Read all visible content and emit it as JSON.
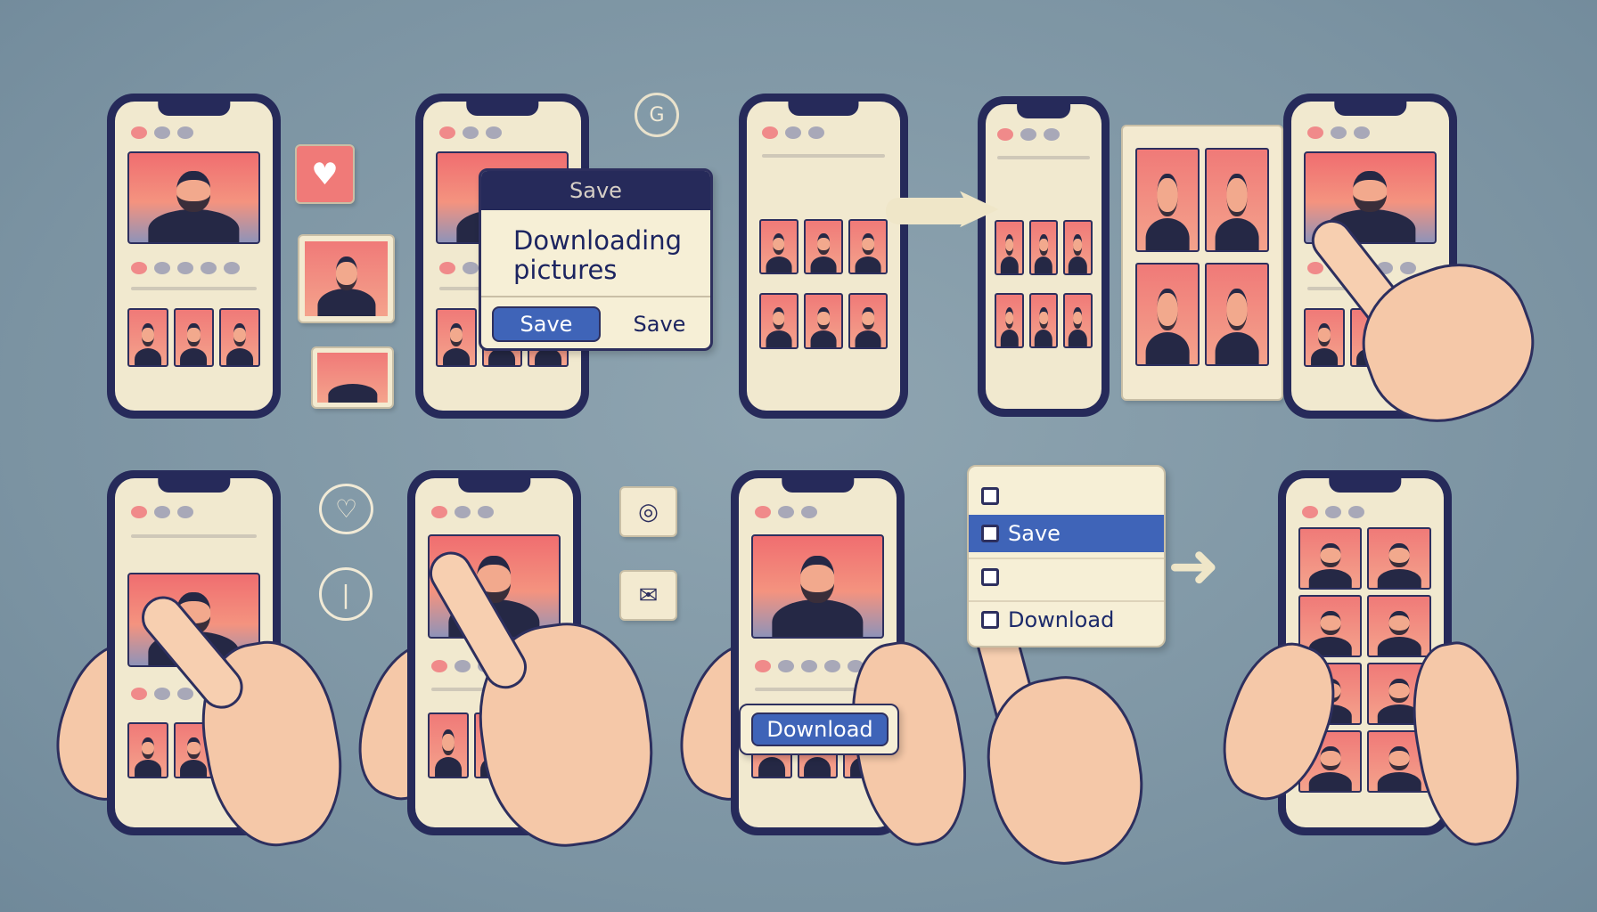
{
  "dialog": {
    "header": "Save",
    "message": "Downloading pictures",
    "primary_button": "Save",
    "secondary_button": "Save"
  },
  "menu": {
    "items": [
      "",
      "Save",
      "",
      "Download"
    ]
  },
  "download_button": "Download",
  "colors": {
    "background": "#7f97a5",
    "phone_frame": "#262a5a",
    "screen": "#f1e9cf",
    "accent_blue": "#3f64b8",
    "photo_pink": "#f06e70",
    "skin": "#f5c8a8"
  },
  "icons": [
    "heart-icon",
    "image-icon",
    "clock-icon",
    "camera-icon",
    "envelope-icon",
    "arrow-right-icon"
  ]
}
